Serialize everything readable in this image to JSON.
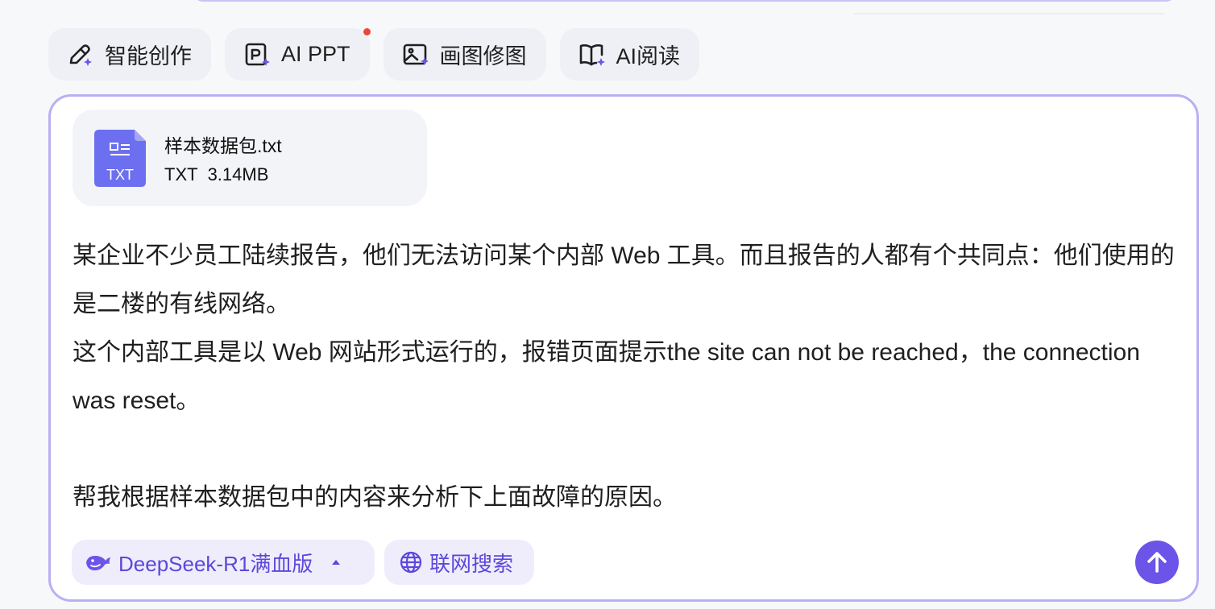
{
  "toolbar": {
    "items": [
      {
        "label": "智能创作",
        "icon": "pen-sparkle-icon"
      },
      {
        "label": "AI PPT",
        "icon": "ppt-sparkle-icon",
        "has_badge": true
      },
      {
        "label": "画图修图",
        "icon": "image-sparkle-icon"
      },
      {
        "label": "AI阅读",
        "icon": "book-sparkle-icon"
      }
    ]
  },
  "attachment": {
    "name": "样本数据包.txt",
    "type": "TXT",
    "size": "3.14MB",
    "icon_label": "TXT"
  },
  "message": {
    "lines": [
      "某企业不少员工陆续报告，他们无法访问某个内部 Web 工具。而且报告的人都有个共同点：他们使用的是二楼的有线网络。",
      "这个内部工具是以 Web 网站形式运行的，报错页面提示the site can not be reached，the connection was reset。",
      "",
      "帮我根据样本数据包中的内容来分析下上面故障的原因。"
    ]
  },
  "controls": {
    "model_label": "DeepSeek-R1满血版",
    "search_label": "联网搜索"
  },
  "colors": {
    "accent": "#6c54e8",
    "accent_light": "#efedfc",
    "border": "#b9b0f4",
    "badge": "#f04438",
    "file_icon": "#6b6ff0"
  }
}
